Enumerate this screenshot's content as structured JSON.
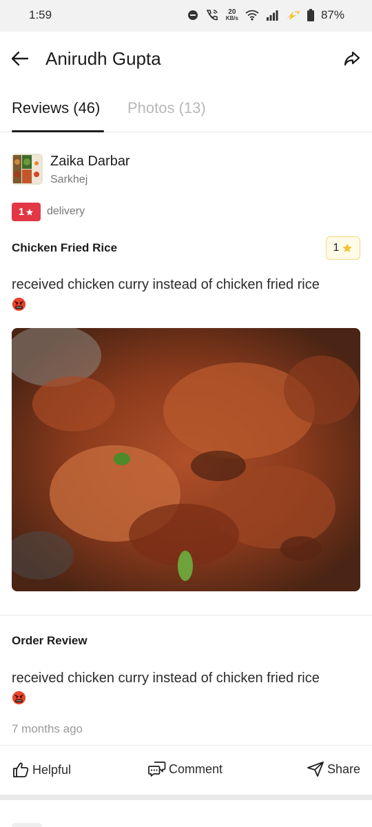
{
  "status_bar": {
    "time": "1:59",
    "net_speed_value": "20",
    "net_speed_unit": "KB/s",
    "battery": "87%"
  },
  "header": {
    "title": "Anirudh Gupta",
    "back_icon": "arrow-left-icon",
    "share_icon": "share-arrow-icon"
  },
  "tabs": [
    {
      "label": "Reviews (46)",
      "active": true
    },
    {
      "label": "Photos (13)",
      "active": false
    }
  ],
  "review": {
    "restaurant": {
      "name": "Zaika Darbar",
      "location": "Sarkhej"
    },
    "rating": {
      "value": "1",
      "type": "delivery",
      "color": "#e23744"
    },
    "dish": {
      "name": "Chicken Fried Rice",
      "rating": "1"
    },
    "text": "received chicken curry instead of chicken fried rice",
    "order_review_title": "Order Review",
    "order_review_text": "received chicken curry instead of chicken fried rice",
    "time_ago": "7 months ago"
  },
  "actions": {
    "helpful": "Helpful",
    "comment": "Comment",
    "share": "Share"
  },
  "colors": {
    "accent_red": "#e23744",
    "star_yellow": "#f2c230"
  }
}
